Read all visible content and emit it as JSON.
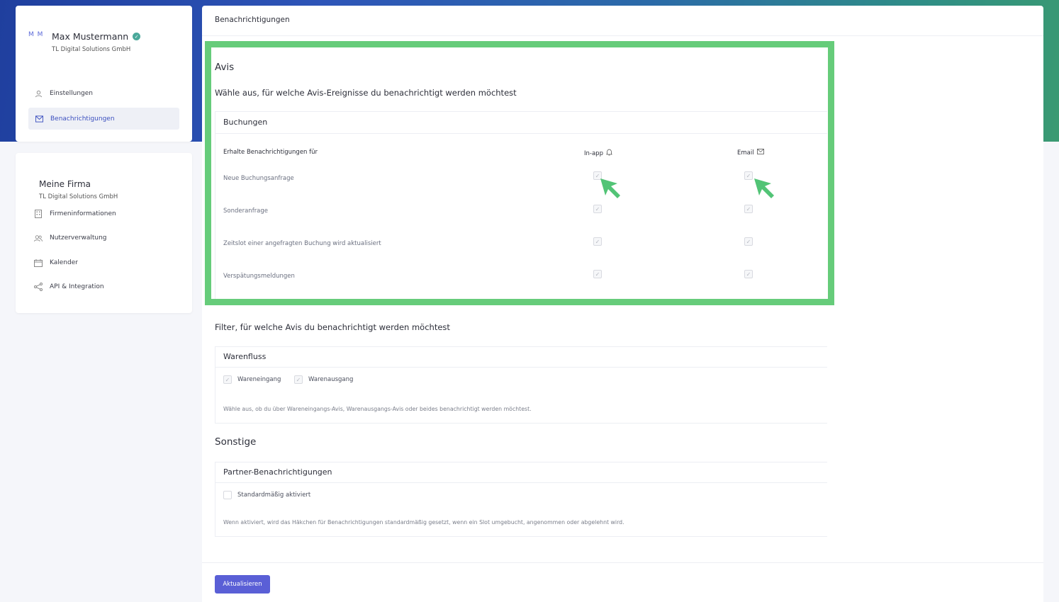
{
  "profile": {
    "initials": "M M",
    "name": "Max Mustermann",
    "company": "TL Digital Solutions GmbH"
  },
  "profile_nav": [
    {
      "label": "Einstellungen",
      "icon": "user-icon"
    },
    {
      "label": "Benachrichtigungen",
      "icon": "mail-icon",
      "active": true
    }
  ],
  "company_section": {
    "title": "Meine Firma",
    "subtitle": "TL Digital Solutions GmbH",
    "items": [
      {
        "label": "Firmeninformationen",
        "icon": "building-icon"
      },
      {
        "label": "Nutzerverwaltung",
        "icon": "users-icon"
      },
      {
        "label": "Kalender",
        "icon": "calendar-icon"
      },
      {
        "label": "API & Integration",
        "icon": "share-icon"
      }
    ]
  },
  "main": {
    "header": "Benachrichtigungen",
    "avis": {
      "title": "Avis",
      "subtitle": "Wähle aus, für welche Avis-Ereignisse du benachrichtigt werden möchtest",
      "panel_title": "Buchungen",
      "col_label": "Erhalte Benachrichtigungen für",
      "col_inapp": "In-app",
      "col_email": "Email",
      "rows": [
        {
          "label": "Neue Buchungsanfrage",
          "inapp": true,
          "email": true
        },
        {
          "label": "Sonderanfrage",
          "inapp": true,
          "email": true
        },
        {
          "label": "Zeitslot einer angefragten Buchung wird aktualisiert",
          "inapp": true,
          "email": true
        },
        {
          "label": "Verspätungsmeldungen",
          "inapp": true,
          "email": true
        }
      ]
    },
    "filter": {
      "title": "Filter, für welche Avis du benachrichtigt werden möchtest",
      "panel_title": "Warenfluss",
      "option_in": "Wareneingang",
      "option_out": "Warenausgang",
      "hint": "Wähle aus, ob du über Wareneingangs-Avis, Warenausgangs-Avis oder beides benachrichtigt werden möchtest."
    },
    "sonstige": {
      "title": "Sonstige",
      "panel_title": "Partner-Benachrichtigungen",
      "option": "Standardmäßig aktiviert",
      "hint": "Wenn aktiviert, wird das Häkchen für Benachrichtigungen standardmäßig gesetzt, wenn ein Slot umgebucht, angenommen oder abgelehnt wird."
    },
    "update_label": "Aktualisieren"
  },
  "colors": {
    "accent": "#5a5fd6",
    "highlight": "#66cc7a",
    "cursor": "#52c476"
  }
}
